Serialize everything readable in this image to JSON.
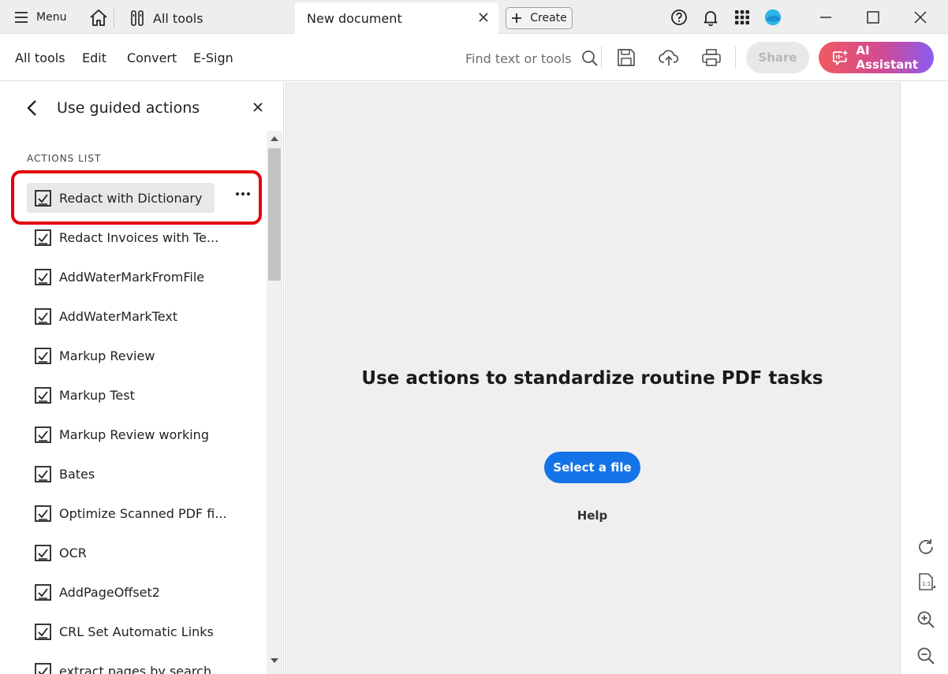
{
  "titlebar": {
    "menu_label": "Menu",
    "all_tools_tab": "All tools",
    "document_tab": "New document",
    "create_label": "Create"
  },
  "menubar": {
    "items": [
      "All tools",
      "Edit",
      "Convert",
      "E-Sign"
    ],
    "search_placeholder": "Find text or tools",
    "share_label": "Share",
    "ai_assistant_label": "AI Assistant"
  },
  "panel": {
    "title": "Use guided actions",
    "section_label": "ACTIONS LIST",
    "items": [
      {
        "label": "Redact with Dictionary",
        "selected": true
      },
      {
        "label": "Redact Invoices with Te..."
      },
      {
        "label": "AddWaterMarkFromFile"
      },
      {
        "label": "AddWaterMarkText"
      },
      {
        "label": "Markup Review"
      },
      {
        "label": "Markup Test"
      },
      {
        "label": "Markup Review working"
      },
      {
        "label": "Bates"
      },
      {
        "label": "Optimize Scanned PDF fi..."
      },
      {
        "label": "OCR"
      },
      {
        "label": "AddPageOffset2"
      },
      {
        "label": "CRL Set Automatic Links"
      },
      {
        "label": "extract pages by search"
      }
    ]
  },
  "main": {
    "heading": "Use actions to standardize routine PDF tasks",
    "select_file_label": "Select a file",
    "help_label": "Help"
  },
  "colors": {
    "primary_button": "#1473e6",
    "highlight_outline": "#e4000c",
    "ai_gradient_start": "#f05a61",
    "ai_gradient_end": "#8a5cf0"
  }
}
